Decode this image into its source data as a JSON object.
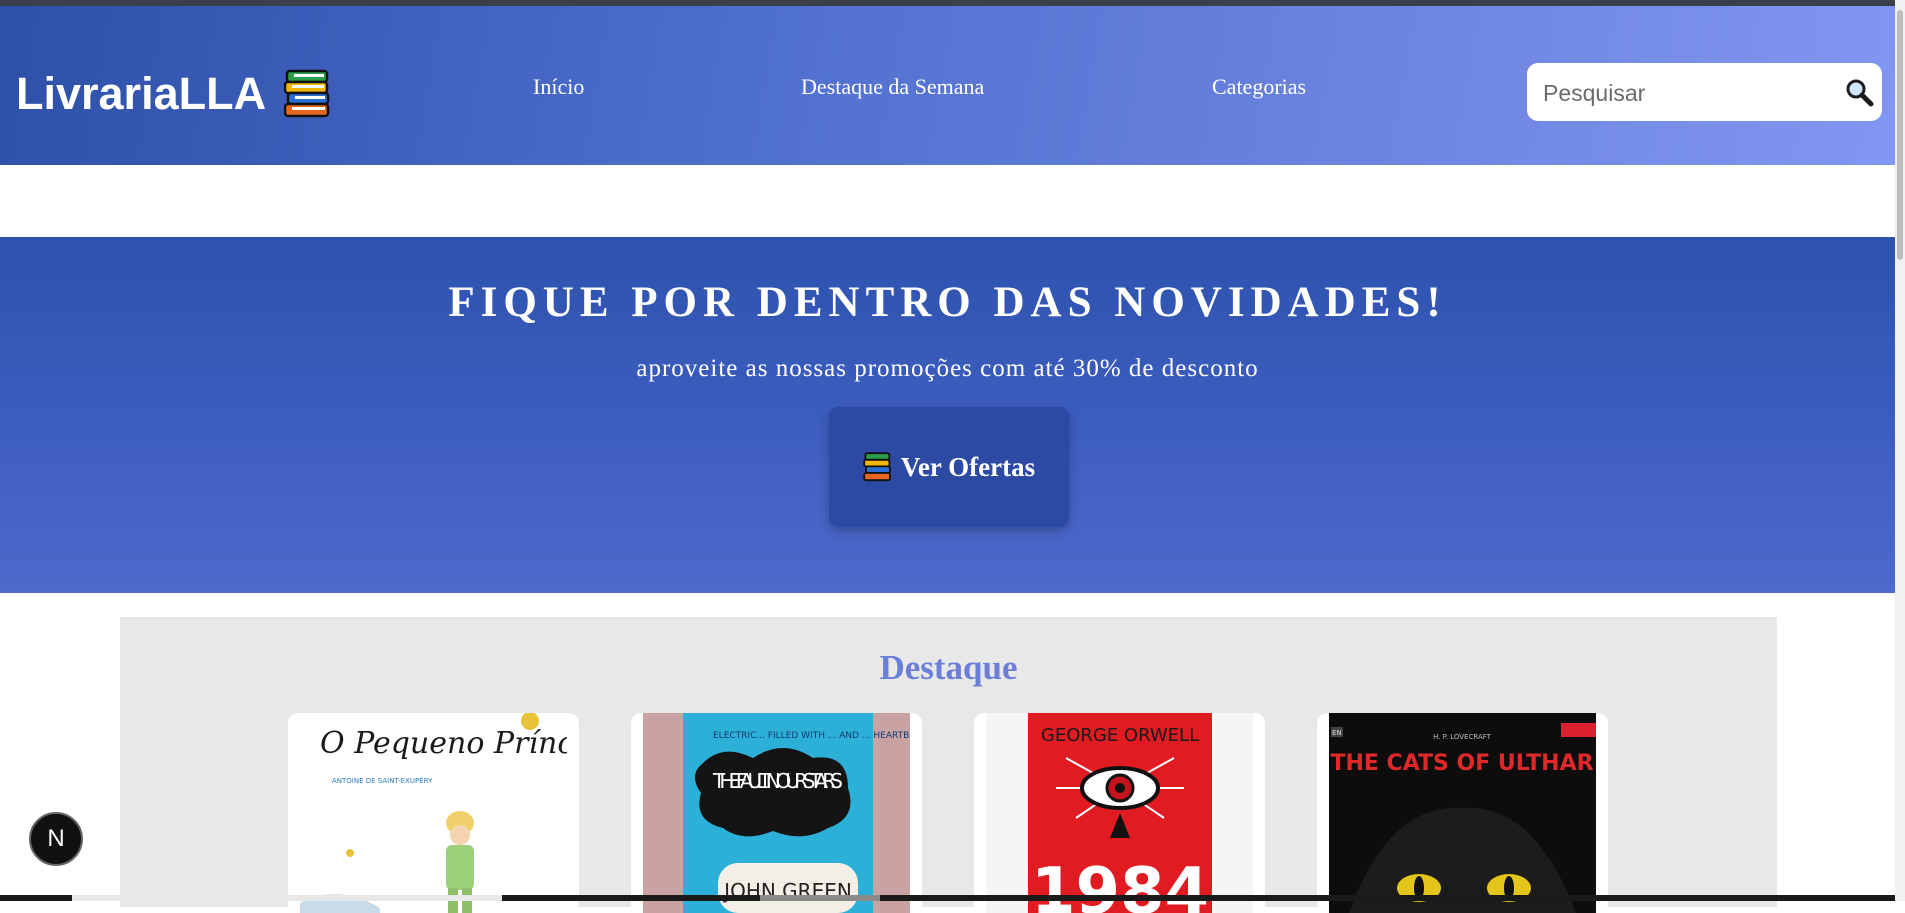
{
  "header": {
    "logo_text": "LivrariaLLA",
    "nav": [
      "Início",
      "Destaque da Semana",
      "Categorias"
    ],
    "search_placeholder": "Pesquisar"
  },
  "hero": {
    "title": "FIQUE POR DENTRO DAS NOVIDADES!",
    "subtitle": "aproveite as nossas promoções com até 30% de desconto",
    "button_label": "Ver Ofertas"
  },
  "featured": {
    "title": "Destaque",
    "books": [
      {
        "cover_title": "O Pequeno Príncipe",
        "cover_author": "ANTOINE DE SAINT-EXUPÉRY"
      },
      {
        "cover_title": "THE FAULT IN OUR STARS",
        "cover_author": "JOHN GREEN",
        "cover_quote": "ELECTRIC... FILLED WITH ... AND ... HEARTBREAK"
      },
      {
        "cover_title": "1984",
        "cover_author": "GEORGE ORWELL"
      },
      {
        "cover_title": "THE CATS OF ULTHAR",
        "cover_author": "H. P. LOVECRAFT",
        "cover_badge": "EN"
      }
    ]
  },
  "dev_badge": "N",
  "colors": {
    "header_start": "#2d50a8",
    "header_end": "#8196f2",
    "hero_bg": "#3e5ec0",
    "button_bg": "#2c4aa4",
    "featured_title": "#6c7fd8",
    "featured_bg": "#e8e8e8"
  }
}
